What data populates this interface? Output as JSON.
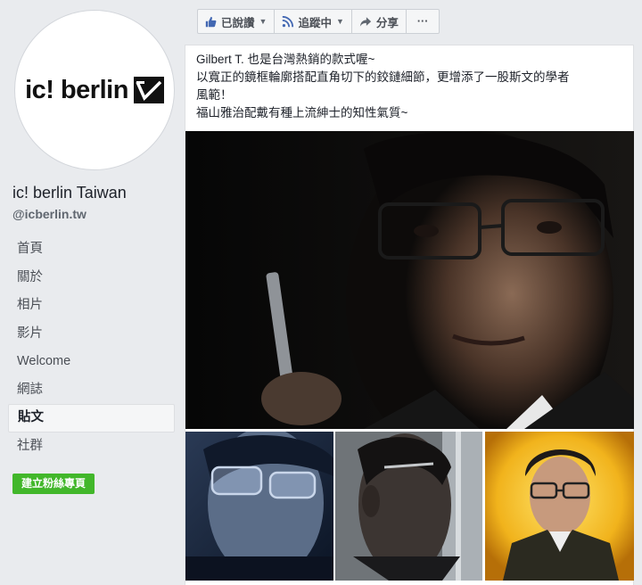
{
  "sidebar": {
    "logo_text": "ic! berlin",
    "page_name": "ic! berlin Taiwan",
    "page_handle": "@icberlin.tw",
    "nav": [
      {
        "label": "首頁",
        "active": false
      },
      {
        "label": "關於",
        "active": false
      },
      {
        "label": "相片",
        "active": false
      },
      {
        "label": "影片",
        "active": false
      },
      {
        "label": "Welcome",
        "active": false
      },
      {
        "label": "網誌",
        "active": false
      },
      {
        "label": "貼文",
        "active": true
      },
      {
        "label": "社群",
        "active": false
      }
    ],
    "cta_label": "建立粉絲專頁"
  },
  "actionbar": {
    "liked_label": "已說讚",
    "follow_label": "追蹤中",
    "share_label": "分享",
    "more_label": "···"
  },
  "post": {
    "lines": [
      "Gilbert T. 也是台灣熱銷的款式喔~",
      "以寬正的鏡框輪廓搭配直角切下的鉸鏈細節，更增添了一股斯文的學者",
      "風範！",
      "福山雅治配戴有種上流紳士的知性氣質~"
    ]
  },
  "colors": {
    "page_bg": "#e9ebee",
    "link_blue": "#4267b2",
    "cta_green": "#42b72a"
  },
  "icons": [
    "like-thumb-icon",
    "rss-follow-icon",
    "share-arrow-icon",
    "more-dots-icon",
    "caret-down-icon"
  ]
}
